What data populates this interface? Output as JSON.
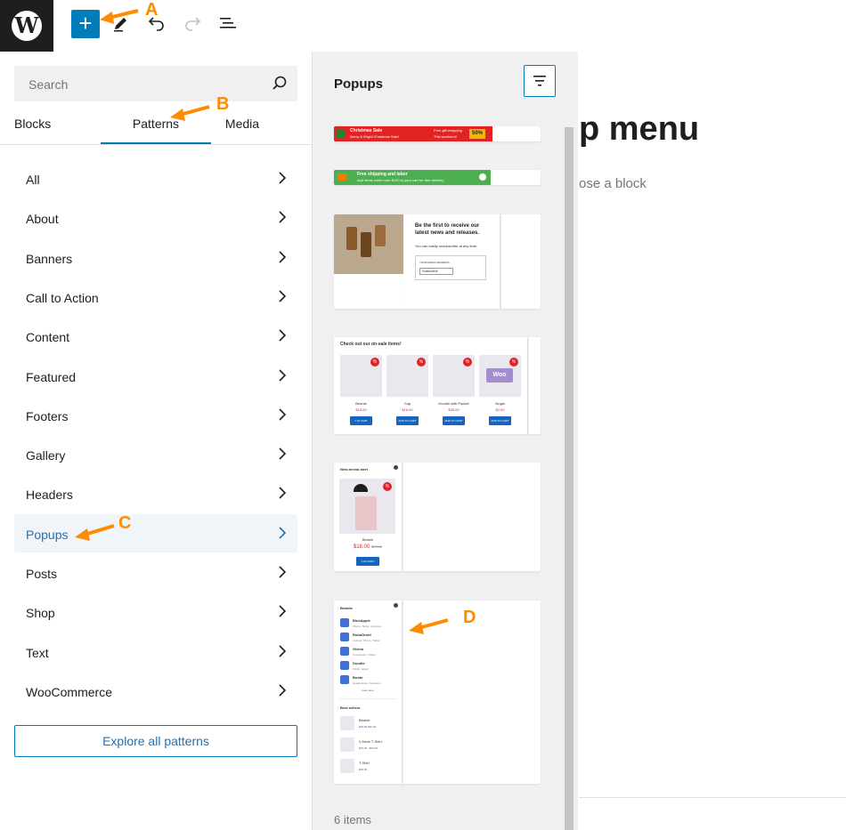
{
  "toolbar": {
    "add_label": "+",
    "wp_logo": "W"
  },
  "sidebar": {
    "search_placeholder": "Search",
    "tabs": {
      "blocks": "Blocks",
      "patterns": "Patterns",
      "media": "Media"
    },
    "categories": [
      "All",
      "About",
      "Banners",
      "Call to Action",
      "Content",
      "Featured",
      "Footers",
      "Gallery",
      "Headers",
      "Popups",
      "Posts",
      "Shop",
      "Text",
      "WooCommerce"
    ],
    "active_category": "Popups",
    "explore_label": "Explore all patterns"
  },
  "preview": {
    "title": "Popups",
    "items_count": "6 items",
    "card1": {
      "title": "Christmas Sale",
      "sub": "Merry & Bright Christmas Sale!",
      "right1": "Free gift wrapping",
      "right2": "This weekend!",
      "badge": "50%"
    },
    "card2": {
      "title": "Free shipping and labor",
      "sub": "Add items worth over $100 to your cart for free delivery"
    },
    "card3": {
      "heading": "Be the first to receive our latest news and releases.",
      "text": "You can easily unsubscribe at any time.",
      "button": "Subscribe",
      "email_label": "YOUR EMAIL ADDRESS"
    },
    "card4": {
      "title": "Check out our on-sale items!",
      "products": [
        {
          "name": "Beanie",
          "price": "$18.00",
          "old": "$20.00",
          "button": "1 IN CART",
          "badge": "%"
        },
        {
          "name": "Cap",
          "price": "$16.00",
          "old": "$18.00",
          "button": "ADD TO CART",
          "badge": "%"
        },
        {
          "name": "Hoodie with Pocket",
          "price": "$35.00",
          "old": "$45.00",
          "button": "ADD TO CART",
          "badge": "%"
        },
        {
          "name": "Single",
          "price": "$2.00",
          "old": "$3.00",
          "button": "ADD TO CART",
          "badge": "%"
        }
      ],
      "woo_logo": "Woo"
    },
    "card5": {
      "title": "New arrival alert",
      "name": "Beanie",
      "price": "$18.00",
      "old": "$20.00",
      "button": "1 IN CART",
      "badge": "%"
    },
    "card6": {
      "brands_title": "Brands",
      "brands": [
        {
          "name": "BlueApple",
          "desc": "Phone, Tablet, notebook"
        },
        {
          "name": "RoboDroid",
          "desc": "Android, Phone, Tablet"
        },
        {
          "name": "Gizmo",
          "desc": "Smartwatch, Tablet"
        },
        {
          "name": "Doodle",
          "desc": "Tablet, laptop"
        },
        {
          "name": "Boots",
          "desc": "Headphones, Speakers"
        }
      ],
      "view_more": "view more",
      "best_title": "Best sellers",
      "best": [
        {
          "name": "Beanie",
          "price": "$18.00 $20.00"
        },
        {
          "name": "V-Neck T-Shirt",
          "price": "$15.00 - $20.00"
        },
        {
          "name": "T-Shirt",
          "price": "$18.00"
        }
      ]
    }
  },
  "canvas": {
    "title": "p menu",
    "hint": "ose a block"
  },
  "annotations": {
    "a": "A",
    "b": "B",
    "c": "C",
    "d": "D"
  },
  "colors": {
    "accent": "#007cba",
    "annotation": "#ff8c00",
    "sale_red": "#e02424",
    "promo_green": "#4caf50"
  }
}
